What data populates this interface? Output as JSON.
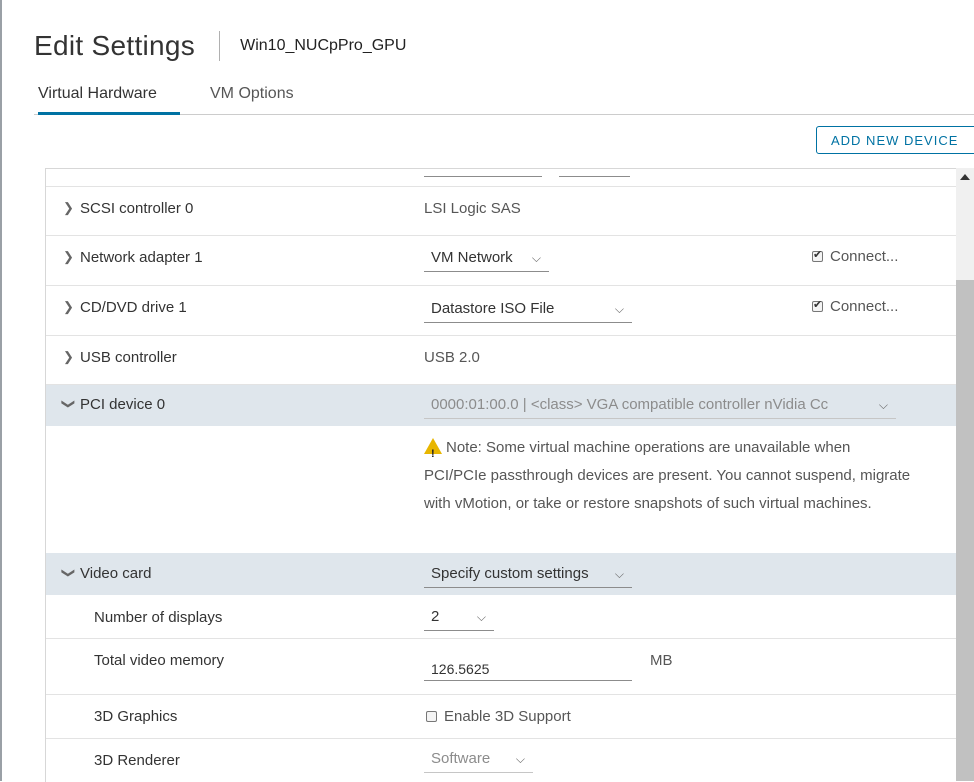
{
  "header": {
    "title": "Edit Settings",
    "vm_name": "Win10_NUCpPro_GPU"
  },
  "tabs": [
    {
      "label": "Virtual Hardware",
      "active": true
    },
    {
      "label": "VM Options",
      "active": false
    }
  ],
  "toolbar": {
    "add_device_label": "ADD NEW DEVICE"
  },
  "hardware": {
    "scsi": {
      "label": "SCSI controller 0",
      "value": "LSI Logic SAS"
    },
    "network": {
      "label": "Network adapter 1",
      "network_value": "VM Network",
      "connect_label": "Connect...",
      "connected": true
    },
    "cddvd": {
      "label": "CD/DVD drive 1",
      "media_value": "Datastore ISO File",
      "connect_label": "Connect...",
      "connected": true
    },
    "usb": {
      "label": "USB controller",
      "value": "USB 2.0"
    },
    "pci": {
      "label": "PCI device 0",
      "device_value": "0000:01:00.0 | <class> VGA compatible controller nVidia Cc",
      "note": "Note: Some virtual machine operations are unavailable when PCI/PCIe passthrough devices are present. You cannot suspend, migrate with vMotion, or take or restore snapshots of such virtual machines."
    },
    "video": {
      "label": "Video card",
      "settings_value": "Specify custom settings",
      "displays_label": "Number of displays",
      "displays_value": "2",
      "memory_label": "Total video memory",
      "memory_value": "126.5625",
      "memory_unit": "MB",
      "graphics_label": "3D Graphics",
      "enable3d_label": "Enable 3D Support",
      "enable3d_checked": false,
      "renderer_label": "3D Renderer",
      "renderer_value": "Software"
    }
  },
  "colors": {
    "accent": "#0072a3",
    "expanded_row": "#dfe6ec",
    "warning": "#e8b600"
  },
  "icons": {
    "collapsed": "chevron-right-icon",
    "expanded": "chevron-down-icon",
    "dropdown": "caret-down-icon",
    "warning": "warning-triangle-icon"
  }
}
